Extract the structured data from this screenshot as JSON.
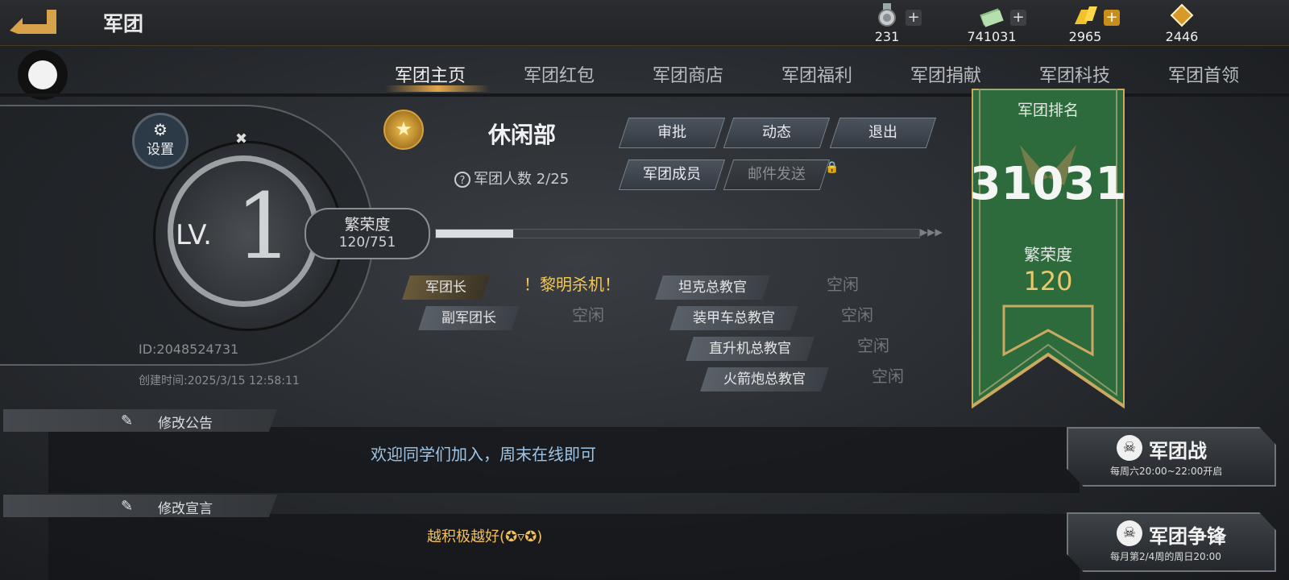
{
  "header": {
    "title": "军团"
  },
  "resources": [
    {
      "icon": "medal-icon",
      "value": "231",
      "has_plus": true
    },
    {
      "icon": "cash-stack-icon",
      "value": "741031",
      "has_plus": true
    },
    {
      "icon": "gold-bars-icon",
      "value": "2965",
      "has_plus": true
    },
    {
      "icon": "diamond-icon",
      "value": "2446",
      "has_plus": false
    }
  ],
  "tabs": [
    "军团主页",
    "军团红包",
    "军团商店",
    "军团福利",
    "军团捐献",
    "军团科技",
    "军团首领"
  ],
  "active_tab": 0,
  "level": {
    "label": "LV.",
    "value": "1"
  },
  "settings_label": "设置",
  "prosperity": {
    "label": "繁荣度",
    "value": "120/751",
    "progress": 0.16
  },
  "guild": {
    "name": "休闲部",
    "id": "ID:2048524731",
    "created": "创建时间:2025/3/15 12:58:11",
    "members": "军团人数 2/25",
    "help_icon": "?"
  },
  "actions": {
    "approve": "审批",
    "activity": "动态",
    "quit": "退出",
    "members": "军团成员",
    "mail": "邮件发送"
  },
  "roles": [
    {
      "title": "军团长",
      "holder": "！黎明杀机！"
    },
    {
      "title": "副军团长",
      "holder": "空闲"
    },
    {
      "title": "坦克总教官",
      "holder": "空闲"
    },
    {
      "title": "装甲车总教官",
      "holder": "空闲"
    },
    {
      "title": "直升机总教官",
      "holder": "空闲"
    },
    {
      "title": "火箭炮总教官",
      "holder": "空闲"
    }
  ],
  "ranking": {
    "title": "军团排名",
    "rank": "31031",
    "prosperity_label": "繁荣度",
    "prosperity_value": "120"
  },
  "announcement": {
    "edit_label": "修改公告",
    "text": "欢迎同学们加入，周末在线即可"
  },
  "declaration": {
    "edit_label": "修改宣言",
    "text": "越积极越好(✪▿✪)"
  },
  "battles": [
    {
      "title": "军团战",
      "schedule": "每周六20:00~22:00开启"
    },
    {
      "title": "军团争锋",
      "schedule": "每月第2/4周的周日20:00"
    }
  ],
  "colors": {
    "accent_gold": "#f3c552",
    "banner_green": "#2e6b3c",
    "notice_blue": "#9ec4e6"
  }
}
